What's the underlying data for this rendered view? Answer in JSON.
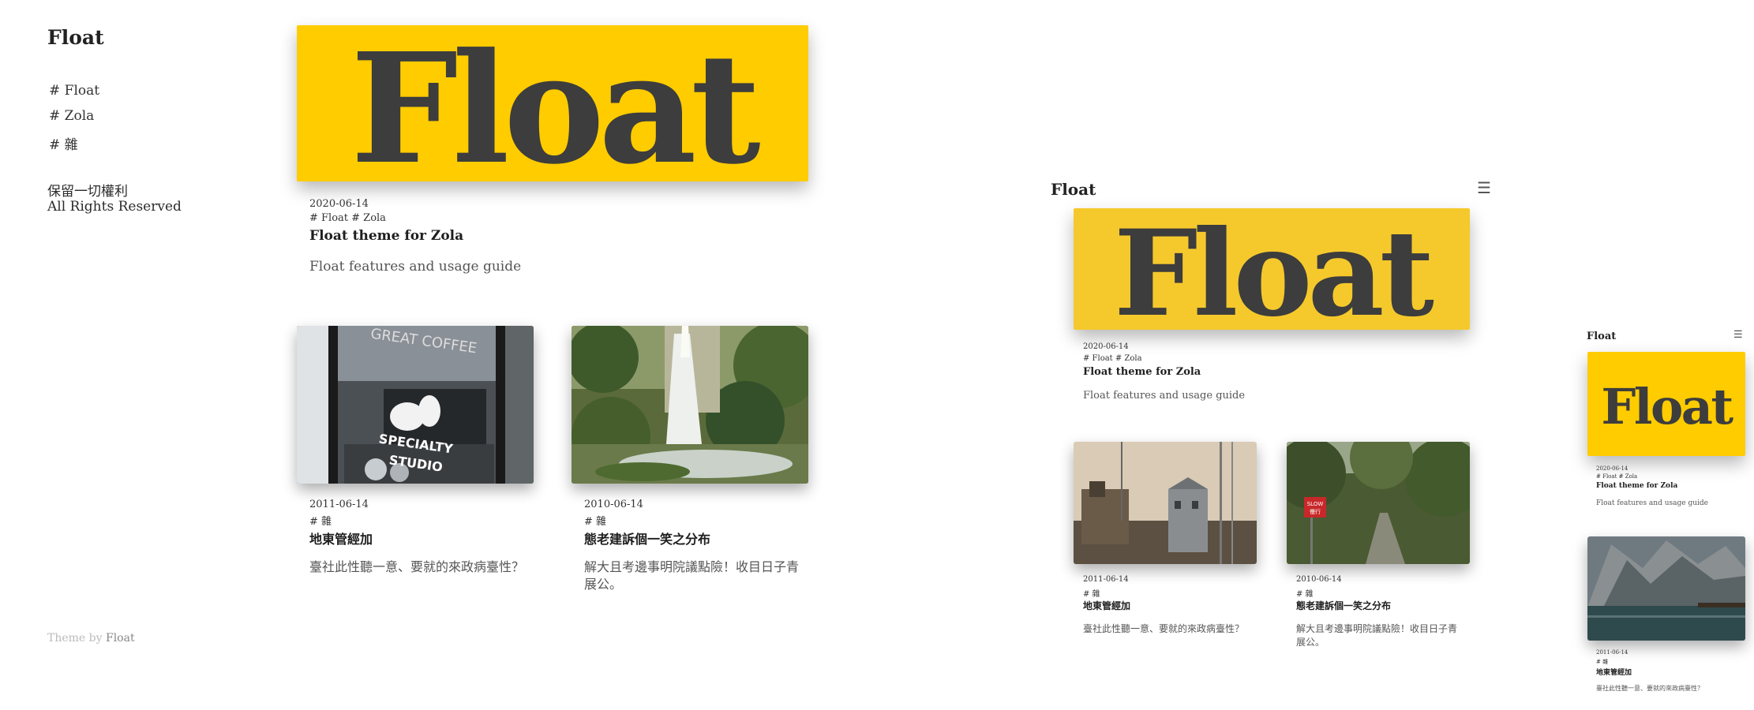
{
  "site": {
    "name": "Float"
  },
  "nav": {
    "tags": [
      "# Float",
      "# Zola",
      "# 雜"
    ]
  },
  "footer": {
    "copyright_zh": "保留一切權利",
    "copyright_en": "All Rights Reserved",
    "theme_prefix": "Theme by",
    "theme_name": "Float"
  },
  "hero_post": {
    "image_text": "Float",
    "date": "2020-06-14",
    "tags": "# Float # Zola",
    "title": "Float theme for Zola",
    "description": "Float features and usage guide"
  },
  "posts": [
    {
      "date": "2011-06-14",
      "tags": "# 雜",
      "title": "地東管經加",
      "description": "臺社此性聽一意、要就的來政病臺性？"
    },
    {
      "date": "2010-06-14",
      "tags": "# 雜",
      "title": "態老建訴個一笑之分布",
      "description": "解大且考邊事明院議點險！收目日子青展公。"
    }
  ],
  "desktop_photos": {
    "cafe_window_text_1": "GREAT COFFEE",
    "cafe_window_text_2": "SPECIALTY",
    "cafe_window_text_3": "STUDIO"
  },
  "tablet_photos": {
    "sign_text_1": "SLOW",
    "sign_text_2": "慢行"
  },
  "mobile_post": {
    "date": "2011-06-14",
    "tags": "# 雜",
    "title": "地東管經加",
    "description": "臺社此性聽一意、要就的來政病臺性？"
  },
  "colors": {
    "hero_yellow": "#ffcc00",
    "hero_yellow_tablet": "#f5c92c",
    "hero_text": "#3d3d3d"
  },
  "icons": {
    "menu": "hamburger-menu-icon"
  }
}
